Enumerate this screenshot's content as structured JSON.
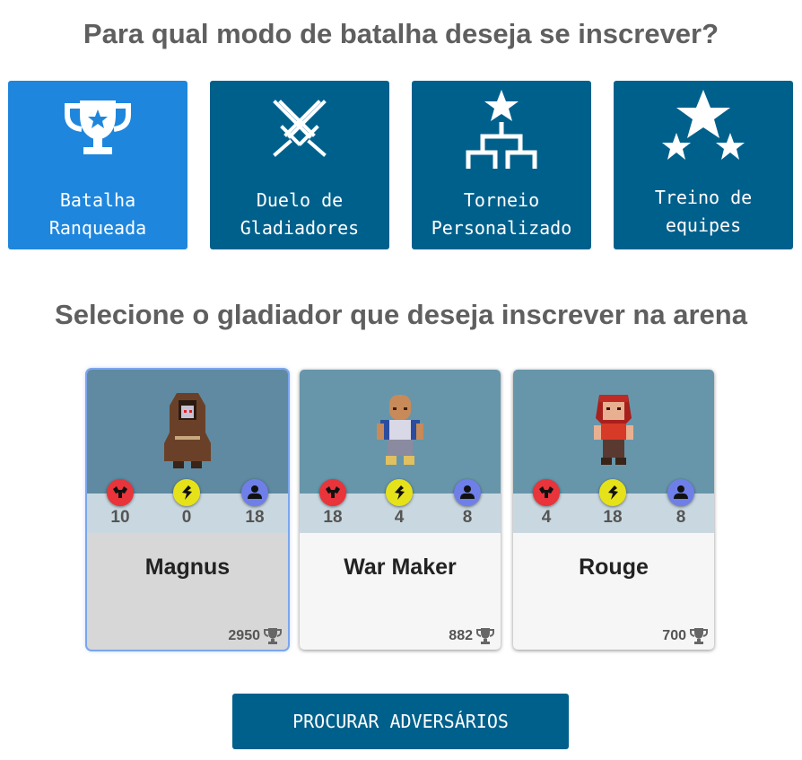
{
  "header": {
    "mode_question": "Para qual modo de batalha deseja se inscrever?"
  },
  "modes": [
    {
      "line1": "Batalha",
      "line2": "Ranqueada",
      "icon": "trophy-icon",
      "selected": true
    },
    {
      "line1": "Duelo de",
      "line2": "Gladiadores",
      "icon": "crossed-swords-icon",
      "selected": false
    },
    {
      "line1": "Torneio",
      "line2": "Personalizado",
      "icon": "tournament-bracket-icon",
      "selected": false
    },
    {
      "line1": "Treino de",
      "line2": "equipes",
      "icon": "stars-icon",
      "selected": false
    }
  ],
  "gladiator_section": {
    "title": "Selecione o gladiador que deseja inscrever na arena"
  },
  "attributes": [
    {
      "icon": "strength-icon",
      "color": "#e8343a"
    },
    {
      "icon": "agility-icon",
      "color": "#e6e21a"
    },
    {
      "icon": "intelligence-icon",
      "color": "#6f7fe8"
    }
  ],
  "gladiators": [
    {
      "name": "Magnus",
      "str": "10",
      "agi": "0",
      "int": "18",
      "rank": "2950",
      "selected": true,
      "avatar": "hooded-monk-sprite"
    },
    {
      "name": "War Maker",
      "str": "18",
      "agi": "4",
      "int": "8",
      "rank": "882",
      "selected": false,
      "avatar": "bald-warrior-sprite"
    },
    {
      "name": "Rouge",
      "str": "4",
      "agi": "18",
      "int": "8",
      "rank": "700",
      "selected": false,
      "avatar": "red-haired-fighter-sprite"
    }
  ],
  "actions": {
    "search_label": "PROCURAR ADVERSÁRIOS"
  },
  "colors": {
    "mode_bg": "#00608c",
    "mode_active": "#1e86dd",
    "card_art": "#6796aa",
    "card_stats": "#c9d8e0"
  }
}
